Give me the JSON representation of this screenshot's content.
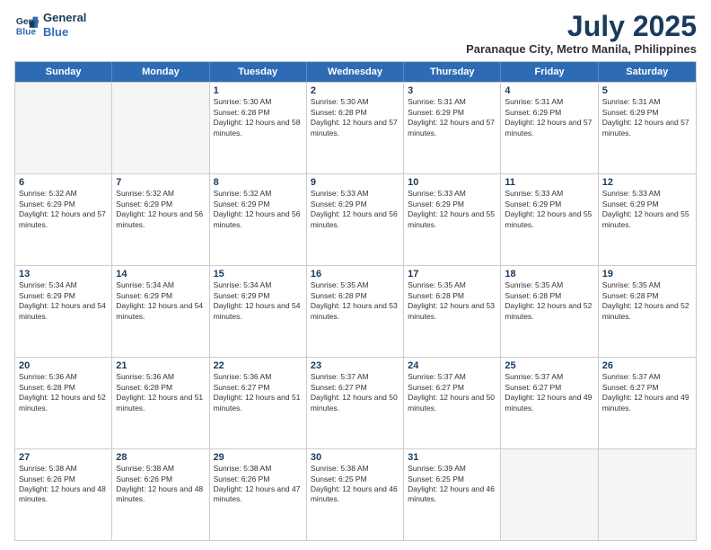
{
  "header": {
    "logo_line1": "General",
    "logo_line2": "Blue",
    "month": "July 2025",
    "location": "Paranaque City, Metro Manila, Philippines"
  },
  "days": [
    "Sunday",
    "Monday",
    "Tuesday",
    "Wednesday",
    "Thursday",
    "Friday",
    "Saturday"
  ],
  "rows": [
    [
      {
        "day": "",
        "empty": true
      },
      {
        "day": "",
        "empty": true
      },
      {
        "day": "1",
        "sunrise": "5:30 AM",
        "sunset": "6:28 PM",
        "daylight": "12 hours and 58 minutes."
      },
      {
        "day": "2",
        "sunrise": "5:30 AM",
        "sunset": "6:28 PM",
        "daylight": "12 hours and 57 minutes."
      },
      {
        "day": "3",
        "sunrise": "5:31 AM",
        "sunset": "6:29 PM",
        "daylight": "12 hours and 57 minutes."
      },
      {
        "day": "4",
        "sunrise": "5:31 AM",
        "sunset": "6:29 PM",
        "daylight": "12 hours and 57 minutes."
      },
      {
        "day": "5",
        "sunrise": "5:31 AM",
        "sunset": "6:29 PM",
        "daylight": "12 hours and 57 minutes."
      }
    ],
    [
      {
        "day": "6",
        "sunrise": "5:32 AM",
        "sunset": "6:29 PM",
        "daylight": "12 hours and 57 minutes."
      },
      {
        "day": "7",
        "sunrise": "5:32 AM",
        "sunset": "6:29 PM",
        "daylight": "12 hours and 56 minutes."
      },
      {
        "day": "8",
        "sunrise": "5:32 AM",
        "sunset": "6:29 PM",
        "daylight": "12 hours and 56 minutes."
      },
      {
        "day": "9",
        "sunrise": "5:33 AM",
        "sunset": "6:29 PM",
        "daylight": "12 hours and 56 minutes."
      },
      {
        "day": "10",
        "sunrise": "5:33 AM",
        "sunset": "6:29 PM",
        "daylight": "12 hours and 55 minutes."
      },
      {
        "day": "11",
        "sunrise": "5:33 AM",
        "sunset": "6:29 PM",
        "daylight": "12 hours and 55 minutes."
      },
      {
        "day": "12",
        "sunrise": "5:33 AM",
        "sunset": "6:29 PM",
        "daylight": "12 hours and 55 minutes."
      }
    ],
    [
      {
        "day": "13",
        "sunrise": "5:34 AM",
        "sunset": "6:29 PM",
        "daylight": "12 hours and 54 minutes."
      },
      {
        "day": "14",
        "sunrise": "5:34 AM",
        "sunset": "6:29 PM",
        "daylight": "12 hours and 54 minutes."
      },
      {
        "day": "15",
        "sunrise": "5:34 AM",
        "sunset": "6:29 PM",
        "daylight": "12 hours and 54 minutes."
      },
      {
        "day": "16",
        "sunrise": "5:35 AM",
        "sunset": "6:28 PM",
        "daylight": "12 hours and 53 minutes."
      },
      {
        "day": "17",
        "sunrise": "5:35 AM",
        "sunset": "6:28 PM",
        "daylight": "12 hours and 53 minutes."
      },
      {
        "day": "18",
        "sunrise": "5:35 AM",
        "sunset": "6:28 PM",
        "daylight": "12 hours and 52 minutes."
      },
      {
        "day": "19",
        "sunrise": "5:35 AM",
        "sunset": "6:28 PM",
        "daylight": "12 hours and 52 minutes."
      }
    ],
    [
      {
        "day": "20",
        "sunrise": "5:36 AM",
        "sunset": "6:28 PM",
        "daylight": "12 hours and 52 minutes."
      },
      {
        "day": "21",
        "sunrise": "5:36 AM",
        "sunset": "6:28 PM",
        "daylight": "12 hours and 51 minutes."
      },
      {
        "day": "22",
        "sunrise": "5:36 AM",
        "sunset": "6:27 PM",
        "daylight": "12 hours and 51 minutes."
      },
      {
        "day": "23",
        "sunrise": "5:37 AM",
        "sunset": "6:27 PM",
        "daylight": "12 hours and 50 minutes."
      },
      {
        "day": "24",
        "sunrise": "5:37 AM",
        "sunset": "6:27 PM",
        "daylight": "12 hours and 50 minutes."
      },
      {
        "day": "25",
        "sunrise": "5:37 AM",
        "sunset": "6:27 PM",
        "daylight": "12 hours and 49 minutes."
      },
      {
        "day": "26",
        "sunrise": "5:37 AM",
        "sunset": "6:27 PM",
        "daylight": "12 hours and 49 minutes."
      }
    ],
    [
      {
        "day": "27",
        "sunrise": "5:38 AM",
        "sunset": "6:26 PM",
        "daylight": "12 hours and 48 minutes."
      },
      {
        "day": "28",
        "sunrise": "5:38 AM",
        "sunset": "6:26 PM",
        "daylight": "12 hours and 48 minutes."
      },
      {
        "day": "29",
        "sunrise": "5:38 AM",
        "sunset": "6:26 PM",
        "daylight": "12 hours and 47 minutes."
      },
      {
        "day": "30",
        "sunrise": "5:38 AM",
        "sunset": "6:25 PM",
        "daylight": "12 hours and 46 minutes."
      },
      {
        "day": "31",
        "sunrise": "5:39 AM",
        "sunset": "6:25 PM",
        "daylight": "12 hours and 46 minutes."
      },
      {
        "day": "",
        "empty": true
      },
      {
        "day": "",
        "empty": true
      }
    ]
  ]
}
